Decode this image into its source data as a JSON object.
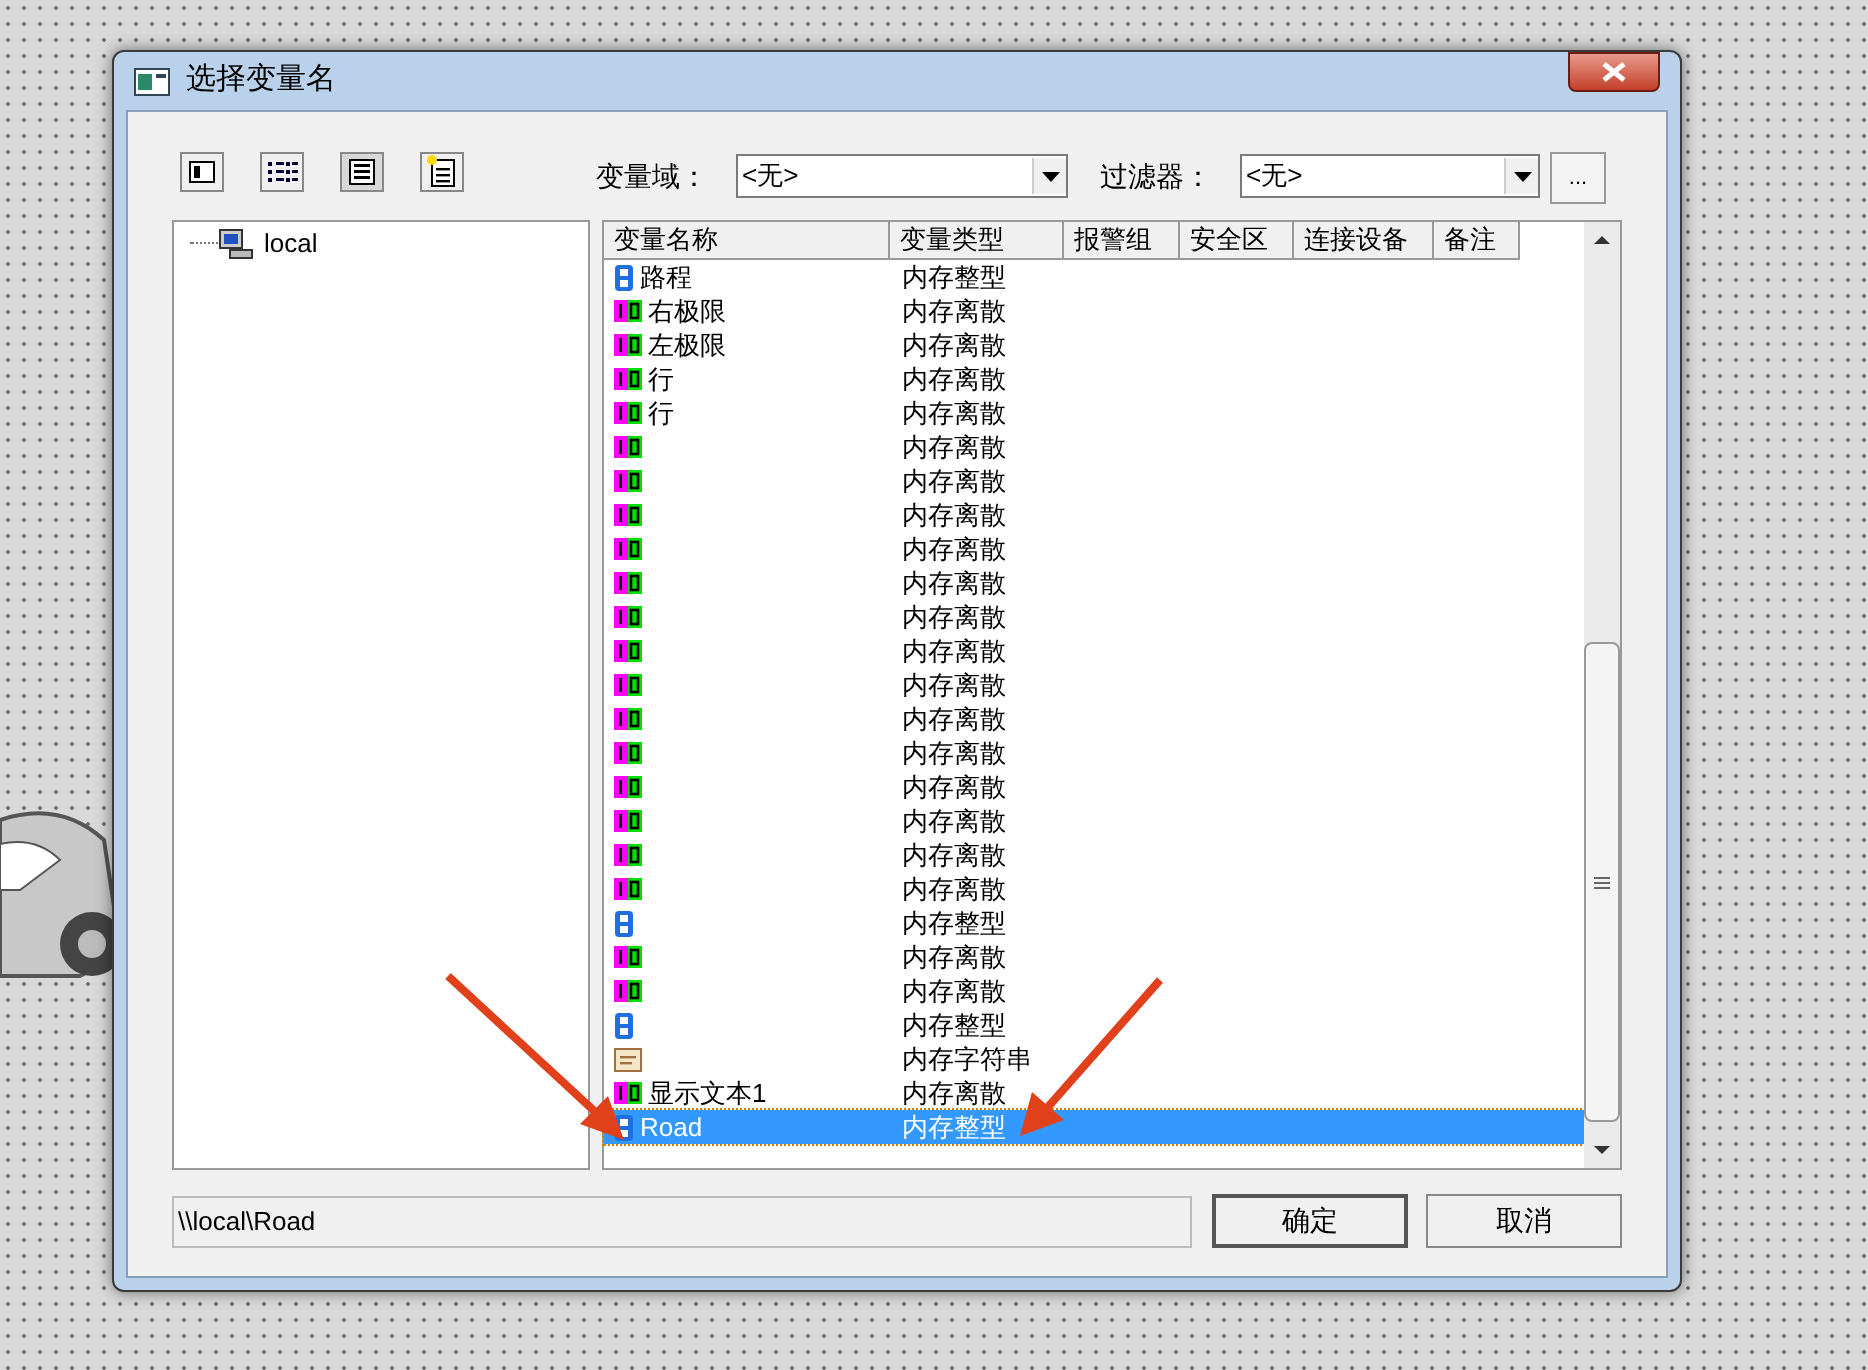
{
  "window": {
    "title": "选择变量名"
  },
  "toolbar": {
    "scope_label": "变量域：",
    "scope_value": "<无>",
    "filter_label": "过滤器：",
    "filter_value": "<无>",
    "more_button": "..."
  },
  "tree": [
    {
      "label": "local",
      "selected": false
    }
  ],
  "table": {
    "columns": [
      "变量名称",
      "变量类型",
      "报警组",
      "安全区",
      "连接设备",
      "备注"
    ],
    "rows": [
      {
        "kind": "int",
        "name": "路程",
        "type": "内存整型",
        "selected": false
      },
      {
        "kind": "discrete",
        "name": "右极限",
        "type": "内存离散",
        "selected": false
      },
      {
        "kind": "discrete",
        "name": "左极限",
        "type": "内存离散",
        "selected": false
      },
      {
        "kind": "discrete",
        "name": "行",
        "type": "内存离散",
        "selected": false
      },
      {
        "kind": "discrete",
        "name": "行",
        "type": "内存离散",
        "selected": false
      },
      {
        "kind": "discrete",
        "type": "内存离散",
        "selected": false
      },
      {
        "kind": "discrete",
        "type": "内存离散",
        "selected": false
      },
      {
        "kind": "discrete",
        "type": "内存离散",
        "selected": false
      },
      {
        "kind": "discrete",
        "type": "内存离散",
        "selected": false
      },
      {
        "kind": "discrete",
        "type": "内存离散",
        "selected": false
      },
      {
        "kind": "discrete",
        "type": "内存离散",
        "selected": false
      },
      {
        "kind": "discrete",
        "type": "内存离散",
        "selected": false
      },
      {
        "kind": "discrete",
        "type": "内存离散",
        "selected": false
      },
      {
        "kind": "discrete",
        "type": "内存离散",
        "selected": false
      },
      {
        "kind": "discrete",
        "type": "内存离散",
        "selected": false
      },
      {
        "kind": "discrete",
        "type": "内存离散",
        "selected": false
      },
      {
        "kind": "discrete",
        "type": "内存离散",
        "selected": false
      },
      {
        "kind": "discrete",
        "type": "内存离散",
        "selected": false
      },
      {
        "kind": "discrete",
        "type": "内存离散",
        "selected": false
      },
      {
        "kind": "int",
        "type": "内存整型",
        "selected": false
      },
      {
        "kind": "discrete",
        "type": "内存离散",
        "selected": false
      },
      {
        "kind": "discrete",
        "type": "内存离散",
        "selected": false
      },
      {
        "kind": "int",
        "type": "内存整型",
        "selected": false
      },
      {
        "kind": "string",
        "type": "内存字符串",
        "selected": false
      },
      {
        "kind": "discrete",
        "name": "显示文本1",
        "type": "内存离散",
        "selected": false
      },
      {
        "kind": "int",
        "name": "Road",
        "type": "内存整型",
        "selected": true
      }
    ]
  },
  "path": "\\\\local\\Road",
  "buttons": [
    "确定",
    "取消"
  ]
}
